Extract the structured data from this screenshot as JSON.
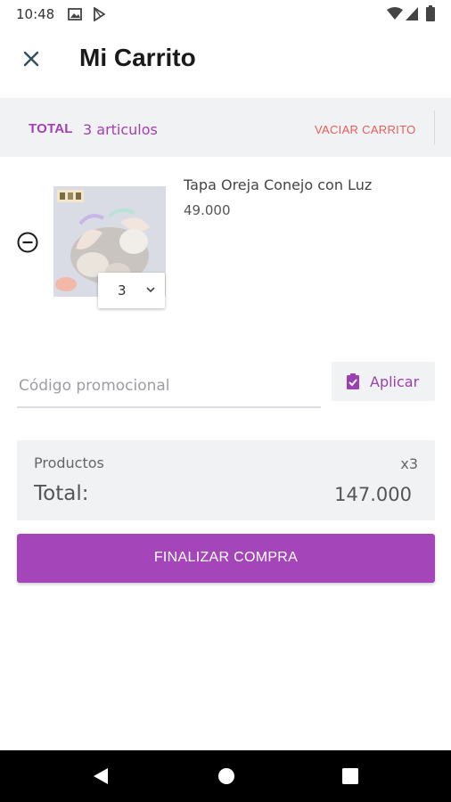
{
  "status_bar": {
    "time": "10:48",
    "icons": [
      "gallery-icon",
      "play-store-icon",
      "wifi-icon",
      "signal-icon",
      "battery-icon"
    ]
  },
  "header": {
    "title": "Mi Carrito",
    "close_icon": "close-icon"
  },
  "summary": {
    "total_label": "TOTAL",
    "count_label": "3 articulos",
    "empty_cart_label": "VACIAR CARRITO"
  },
  "cart_items": [
    {
      "name": "Tapa Oreja Conejo con Luz",
      "price": "49.000",
      "quantity": "3",
      "remove_icon": "minus-circle-icon"
    }
  ],
  "promo": {
    "placeholder": "Código promocional",
    "value": "",
    "apply_label": "Aplicar",
    "apply_icon": "clipboard-check-icon"
  },
  "totals": {
    "products_label": "Productos",
    "products_count": "x3",
    "total_label": "Total:",
    "total_value": "147.000"
  },
  "checkout": {
    "label": "FINALIZAR COMPRA"
  },
  "colors": {
    "accent": "#a446b9",
    "danger": "#ee5a5a",
    "panel": "#f1f2f4"
  }
}
